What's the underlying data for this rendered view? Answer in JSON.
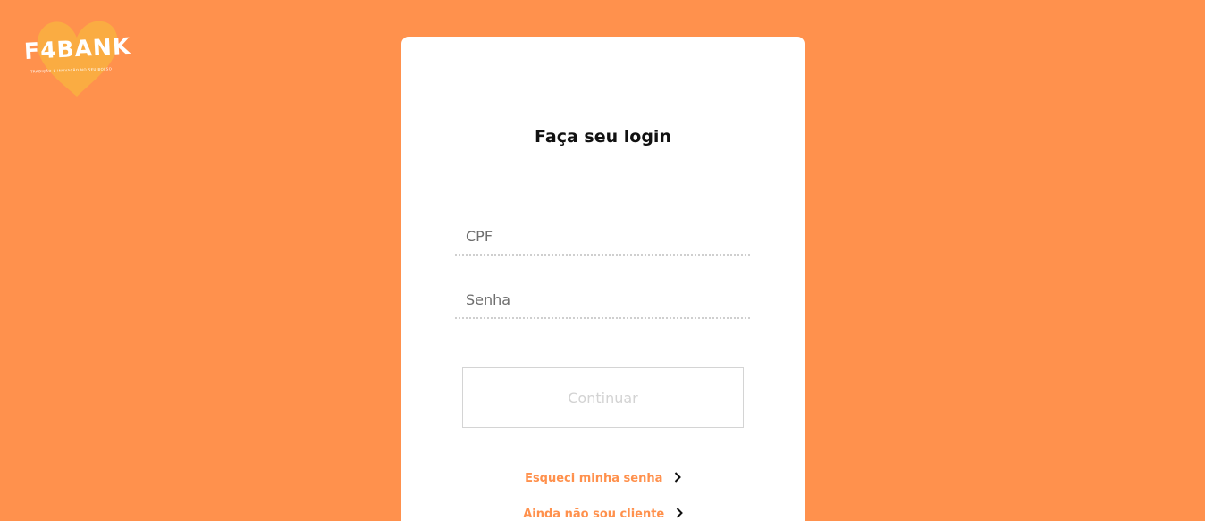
{
  "brand": {
    "name": "F4BANK",
    "tagline": "TRADIÇÃO E INOVAÇÃO NO SEU BOLSO",
    "heart_color": "#F9B041"
  },
  "colors": {
    "background": "#FF914D",
    "card": "#FFFFFF",
    "accent": "#FF914D"
  },
  "login": {
    "title": "Faça seu login",
    "cpf_placeholder": "CPF",
    "password_placeholder": "Senha",
    "continue_label": "Continuar",
    "forgot_password_label": "Esqueci minha senha",
    "not_client_label": "Ainda não sou cliente",
    "chevron_icon": "chevron-right-icon"
  }
}
